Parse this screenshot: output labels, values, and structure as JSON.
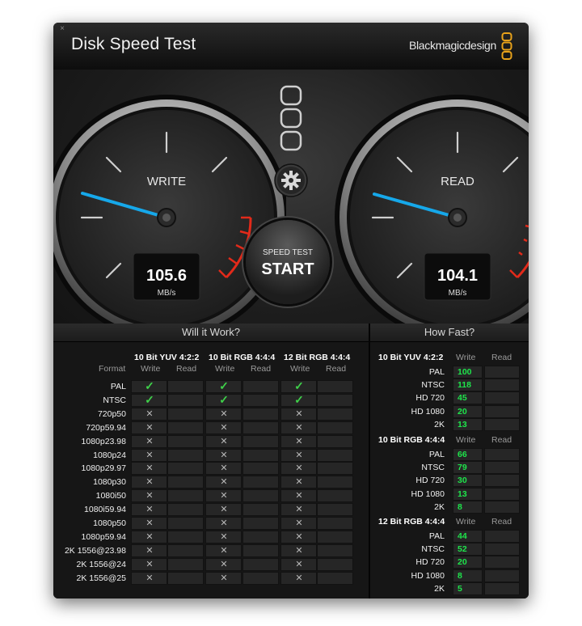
{
  "window": {
    "title": "Disk Speed Test",
    "brand": "Blackmagicdesign",
    "close_glyph": "×"
  },
  "gauges": {
    "write": {
      "label": "WRITE",
      "value": "105.6",
      "unit": "MB/s"
    },
    "read": {
      "label": "READ",
      "value": "104.1",
      "unit": "MB/s"
    }
  },
  "controls": {
    "start_small": "SPEED TEST",
    "start_big": "START",
    "settings_icon": "gear-icon"
  },
  "will_it_work": {
    "title": "Will it Work?",
    "format_label": "Format",
    "groups": [
      {
        "name": "10 Bit YUV 4:2:2",
        "write": "Write",
        "read": "Read"
      },
      {
        "name": "10 Bit RGB 4:4:4",
        "write": "Write",
        "read": "Read"
      },
      {
        "name": "12 Bit RGB 4:4:4",
        "write": "Write",
        "read": "Read"
      }
    ],
    "rows": [
      {
        "format": "PAL",
        "ok": true
      },
      {
        "format": "NTSC",
        "ok": true
      },
      {
        "format": "720p50",
        "ok": false
      },
      {
        "format": "720p59.94",
        "ok": false
      },
      {
        "format": "1080p23.98",
        "ok": false
      },
      {
        "format": "1080p24",
        "ok": false
      },
      {
        "format": "1080p29.97",
        "ok": false
      },
      {
        "format": "1080p30",
        "ok": false
      },
      {
        "format": "1080i50",
        "ok": false
      },
      {
        "format": "1080i59.94",
        "ok": false
      },
      {
        "format": "1080p50",
        "ok": false
      },
      {
        "format": "1080p59.94",
        "ok": false
      },
      {
        "format": "2K 1556@23.98",
        "ok": false
      },
      {
        "format": "2K 1556@24",
        "ok": false
      },
      {
        "format": "2K 1556@25",
        "ok": false
      }
    ],
    "check_glyph": "✓",
    "cross_glyph": "✕"
  },
  "how_fast": {
    "title": "How Fast?",
    "groups": [
      {
        "name": "10 Bit YUV 4:2:2",
        "write": "Write",
        "read": "Read",
        "rows": [
          {
            "label": "PAL",
            "value": "100"
          },
          {
            "label": "NTSC",
            "value": "118"
          },
          {
            "label": "HD 720",
            "value": "45"
          },
          {
            "label": "HD 1080",
            "value": "20"
          },
          {
            "label": "2K",
            "value": "13"
          }
        ]
      },
      {
        "name": "10 Bit RGB 4:4:4",
        "write": "Write",
        "read": "Read",
        "rows": [
          {
            "label": "PAL",
            "value": "66"
          },
          {
            "label": "NTSC",
            "value": "79"
          },
          {
            "label": "HD 720",
            "value": "30"
          },
          {
            "label": "HD 1080",
            "value": "13"
          },
          {
            "label": "2K",
            "value": "8"
          }
        ]
      },
      {
        "name": "12 Bit RGB 4:4:4",
        "write": "Write",
        "read": "Read",
        "rows": [
          {
            "label": "PAL",
            "value": "44"
          },
          {
            "label": "NTSC",
            "value": "52"
          },
          {
            "label": "HD 720",
            "value": "20"
          },
          {
            "label": "HD 1080",
            "value": "8"
          },
          {
            "label": "2K",
            "value": "5"
          }
        ]
      }
    ]
  },
  "colors": {
    "needle": "#16a8ea",
    "redzone": "#e22a1a",
    "value_green": "#1ee54b",
    "check_green": "#3fd14a"
  }
}
